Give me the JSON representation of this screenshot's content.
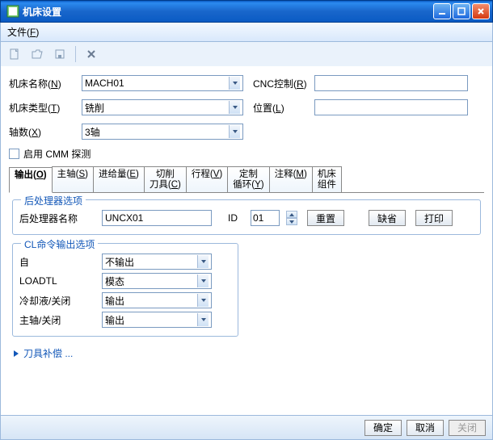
{
  "window": {
    "title": "机床设置"
  },
  "menu": {
    "file": "文件",
    "file_key": "F"
  },
  "toolbar": {
    "new": "新建",
    "open": "打开",
    "save": "保存",
    "delete": "删除"
  },
  "fields": {
    "machine_name": {
      "label": "机床名称",
      "key": "N",
      "value": "MACH01"
    },
    "machine_type": {
      "label": "机床类型",
      "key": "T",
      "value": "铣削"
    },
    "axes": {
      "label": "轴数",
      "key": "X",
      "value": "3轴"
    },
    "cnc_ctrl": {
      "label": "CNC控制",
      "key": "R",
      "value": ""
    },
    "location": {
      "label": "位置",
      "key": "L",
      "value": ""
    },
    "cmm": {
      "label": "启用 CMM 探测",
      "checked": false
    }
  },
  "tabs": [
    {
      "label": "输出",
      "key": "O",
      "active": true
    },
    {
      "label": "主轴",
      "key": "S"
    },
    {
      "label": "进给量",
      "key": "E"
    },
    {
      "label": "切削\n刀具",
      "key": "C"
    },
    {
      "label": "行程",
      "key": "V"
    },
    {
      "label": "定制\n循环",
      "key": "Y"
    },
    {
      "label": "注释",
      "key": "M"
    },
    {
      "label": "机床\n组件",
      "key": ""
    }
  ],
  "post": {
    "group": "后处理器选项",
    "name_label": "后处理器名称",
    "name_value": "UNCX01",
    "id_label": "ID",
    "id_value": "01",
    "reset": "重置",
    "default": "缺省",
    "print": "打印"
  },
  "cl": {
    "group": "CL命令输出选项",
    "rows": [
      {
        "label": "自",
        "value": "不输出"
      },
      {
        "label": "LOADTL",
        "value": "模态"
      },
      {
        "label": "冷却液/关闭",
        "value": "输出"
      },
      {
        "label": "主轴/关闭",
        "value": "输出"
      }
    ]
  },
  "expand": {
    "label": "刀具补偿 ..."
  },
  "footer": {
    "ok": "确定",
    "cancel": "取消",
    "close": "关闭"
  }
}
